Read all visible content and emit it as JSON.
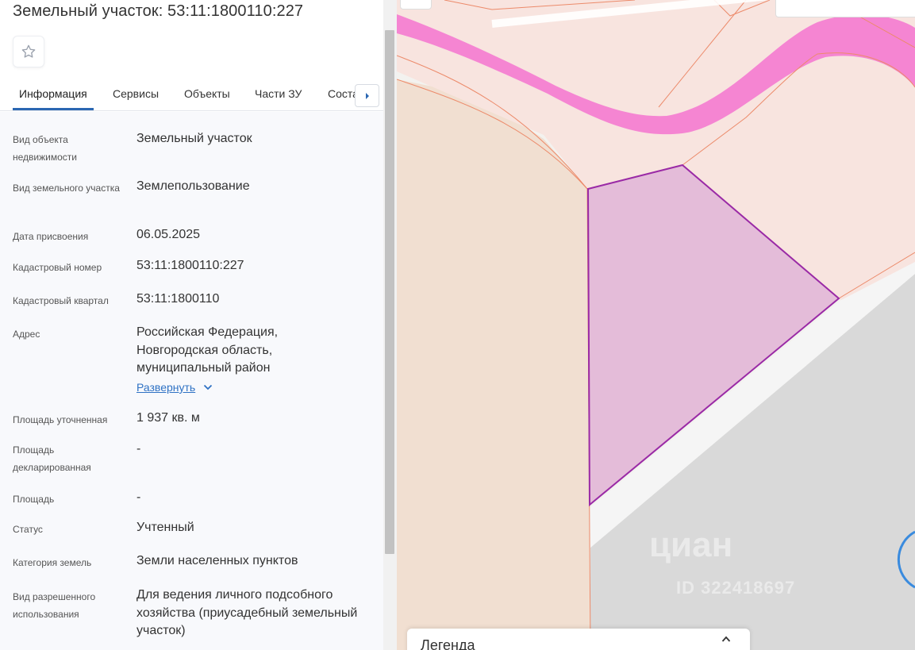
{
  "header": {
    "title": "Земельный участок: 53:11:1800110:227"
  },
  "favorite": {
    "icon": "star-icon"
  },
  "tabs": [
    {
      "label": "Информация",
      "active": true
    },
    {
      "label": "Сервисы"
    },
    {
      "label": "Объекты"
    },
    {
      "label": "Части ЗУ"
    },
    {
      "label": "Соста"
    }
  ],
  "tab_scroll_icon": "chevron-right-icon",
  "info": [
    {
      "label": "Вид объекта недвижимости",
      "value": "Земельный участок"
    },
    {
      "label": "Вид земельного участка",
      "value": "Землепользование"
    },
    {
      "label": "Дата присвоения",
      "value": "06.05.2025"
    },
    {
      "label": "Кадастровый номер",
      "value": "53:11:1800110:227"
    },
    {
      "label": "Кадастровый квартал",
      "value": "53:11:1800110"
    },
    {
      "label": "Адрес",
      "value": "Российская Федерация, Новгородская область, муниципальный район"
    },
    {
      "label": "Площадь уточненная",
      "value": "1 937 кв. м"
    },
    {
      "label": "Площадь декларированная",
      "value": "-"
    },
    {
      "label": "Площадь",
      "value": "-"
    },
    {
      "label": "Статус",
      "value": "Учтенный"
    },
    {
      "label": "Категория земель",
      "value": "Земли населенных пунктов"
    },
    {
      "label": "Вид разрешенного использования",
      "value": "Для ведения личного подсобного хозяйства (приусадебный земельный участок)"
    }
  ],
  "address_expand": {
    "label": "Развернуть",
    "icon": "chevron-down-icon"
  },
  "map": {
    "watermark": "циан",
    "watermark_id": "ID 322418697",
    "legend": {
      "title": "Легенда",
      "icon": "chevron-up-icon"
    },
    "colors": {
      "selected_parcel_fill": "#e4bcd9",
      "selected_parcel_stroke": "#9a2aa6",
      "road_highlight": "#f585d2",
      "parcel_fill": "#f8e4df",
      "parcel_stroke": "#ec8a6a",
      "field_fill": "#f1dfd1",
      "grey_area": "#d9d9d9"
    }
  }
}
